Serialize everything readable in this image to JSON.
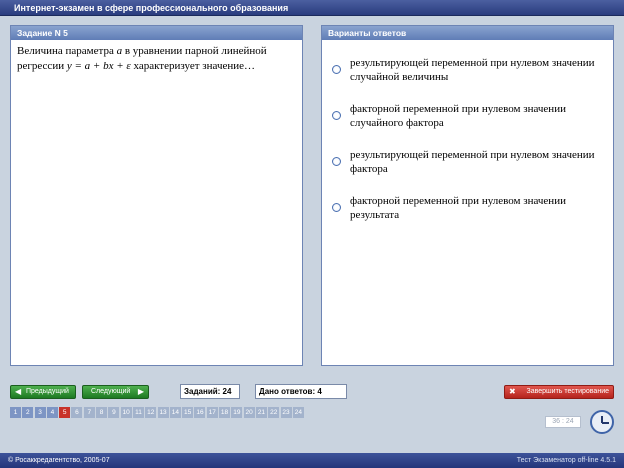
{
  "window": {
    "title": "Интернет-экзамен в сфере профессионального образования"
  },
  "task_panel": {
    "header": "Задание N 5",
    "question_before": "Величина параметра",
    "question_param": "a",
    "question_middle": "в уравнении парной линейной регрессии",
    "question_formula": "y = a + bx + ε",
    "question_after": "характеризует значение…"
  },
  "answers_panel": {
    "header": "Варианты ответов",
    "options": [
      "результирующей переменной при нулевом значении случайной величины",
      "факторной переменной при нулевом значении случайного фактора",
      "результирующей переменной при нулевом значении фактора",
      "факторной переменной при нулевом значении результата"
    ]
  },
  "toolbar": {
    "prev_label": "Предыдущий",
    "next_label": "Следующий",
    "tasks_counter": "Заданий: 24",
    "answers_counter": "Дано ответов: 4",
    "finish_label": "Завершить тестирование"
  },
  "pagination": {
    "pages": [
      "1",
      "2",
      "3",
      "4",
      "5",
      "6",
      "7",
      "8",
      "9",
      "10",
      "11",
      "12",
      "13",
      "14",
      "15",
      "16",
      "17",
      "18",
      "19",
      "20",
      "21",
      "22",
      "23",
      "24"
    ],
    "current": "5"
  },
  "timer": {
    "value": "36 : 24"
  },
  "footer": {
    "copyright": "© Росаккредагентство, 2005-07",
    "version": "Тест Экзаменатор off-line 4.5.1"
  },
  "colors": {
    "accent": "#2a3c7e",
    "nav_green": "#1d7a22",
    "finish_red": "#b5241d",
    "current_page": "#c8322a"
  }
}
